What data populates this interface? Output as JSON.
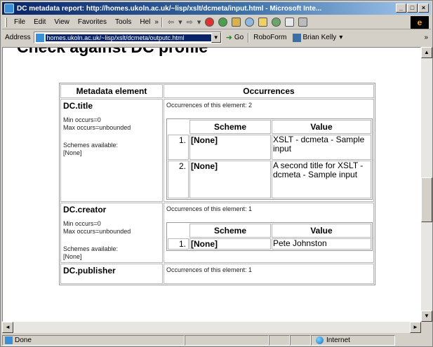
{
  "window": {
    "title": "DC metadata report: http://homes.ukoln.ac.uk/~lisp/xslt/dcmeta/input.html - Microsoft Inte...",
    "minimize": "_",
    "maximize": "□",
    "close": "×"
  },
  "menubar": {
    "items": [
      "File",
      "Edit",
      "View",
      "Favorites",
      "Tools",
      "Hel"
    ],
    "chevron": "»",
    "brand": "e"
  },
  "addressbar": {
    "label": "Address",
    "url": "homes.ukoln.ac.uk/~lisp/xslt/dcmeta/outputc.html",
    "go_label": "Go",
    "roboform": "RoboForm",
    "user": "Brian Kelly",
    "chevron": "»"
  },
  "page": {
    "heading": "Check against DC profile",
    "table": {
      "col1_header": "Metadata element",
      "col2_header": "Occurrences",
      "inner_headers": {
        "scheme": "Scheme",
        "value": "Value"
      },
      "elements": [
        {
          "name": "DC.title",
          "min_occurs": "Min occurs=0",
          "max_occurs": "Max occurs=unbounded",
          "schemes_label": "Schemes available:",
          "schemes_value": "[None]",
          "occurrences": "Occurrences of this element: 2",
          "rows": [
            {
              "num": "1.",
              "scheme": "[None]",
              "value": "XSLT - dcmeta - Sample input"
            },
            {
              "num": "2.",
              "scheme": "[None]",
              "value": "A second title for XSLT - dcmeta - Sample input"
            }
          ]
        },
        {
          "name": "DC.creator",
          "min_occurs": "Min occurs=0",
          "max_occurs": "Max occurs=unbounded",
          "schemes_label": "Schemes available:",
          "schemes_value": "[None]",
          "occurrences": "Occurrences of this element: 1",
          "rows": [
            {
              "num": "1.",
              "scheme": "[None]",
              "value": "Pete Johnston"
            }
          ]
        },
        {
          "name": "DC.publisher",
          "occurrences": "Occurrences of this element: 1"
        }
      ]
    }
  },
  "statusbar": {
    "status": "Done",
    "zone": "Internet"
  },
  "scroll": {
    "up": "▲",
    "down": "▼",
    "left": "◄",
    "right": "►"
  },
  "colors": {
    "title_bar": "#0a246a",
    "chrome": "#d4d0c8"
  },
  "icons": [
    "ie-page-icon",
    "back-icon",
    "forward-icon",
    "stop-icon",
    "refresh-icon",
    "home-icon",
    "search-icon",
    "favorites-icon",
    "history-icon",
    "mail-icon",
    "print-icon",
    "go-arrow-icon",
    "globe-icon"
  ]
}
